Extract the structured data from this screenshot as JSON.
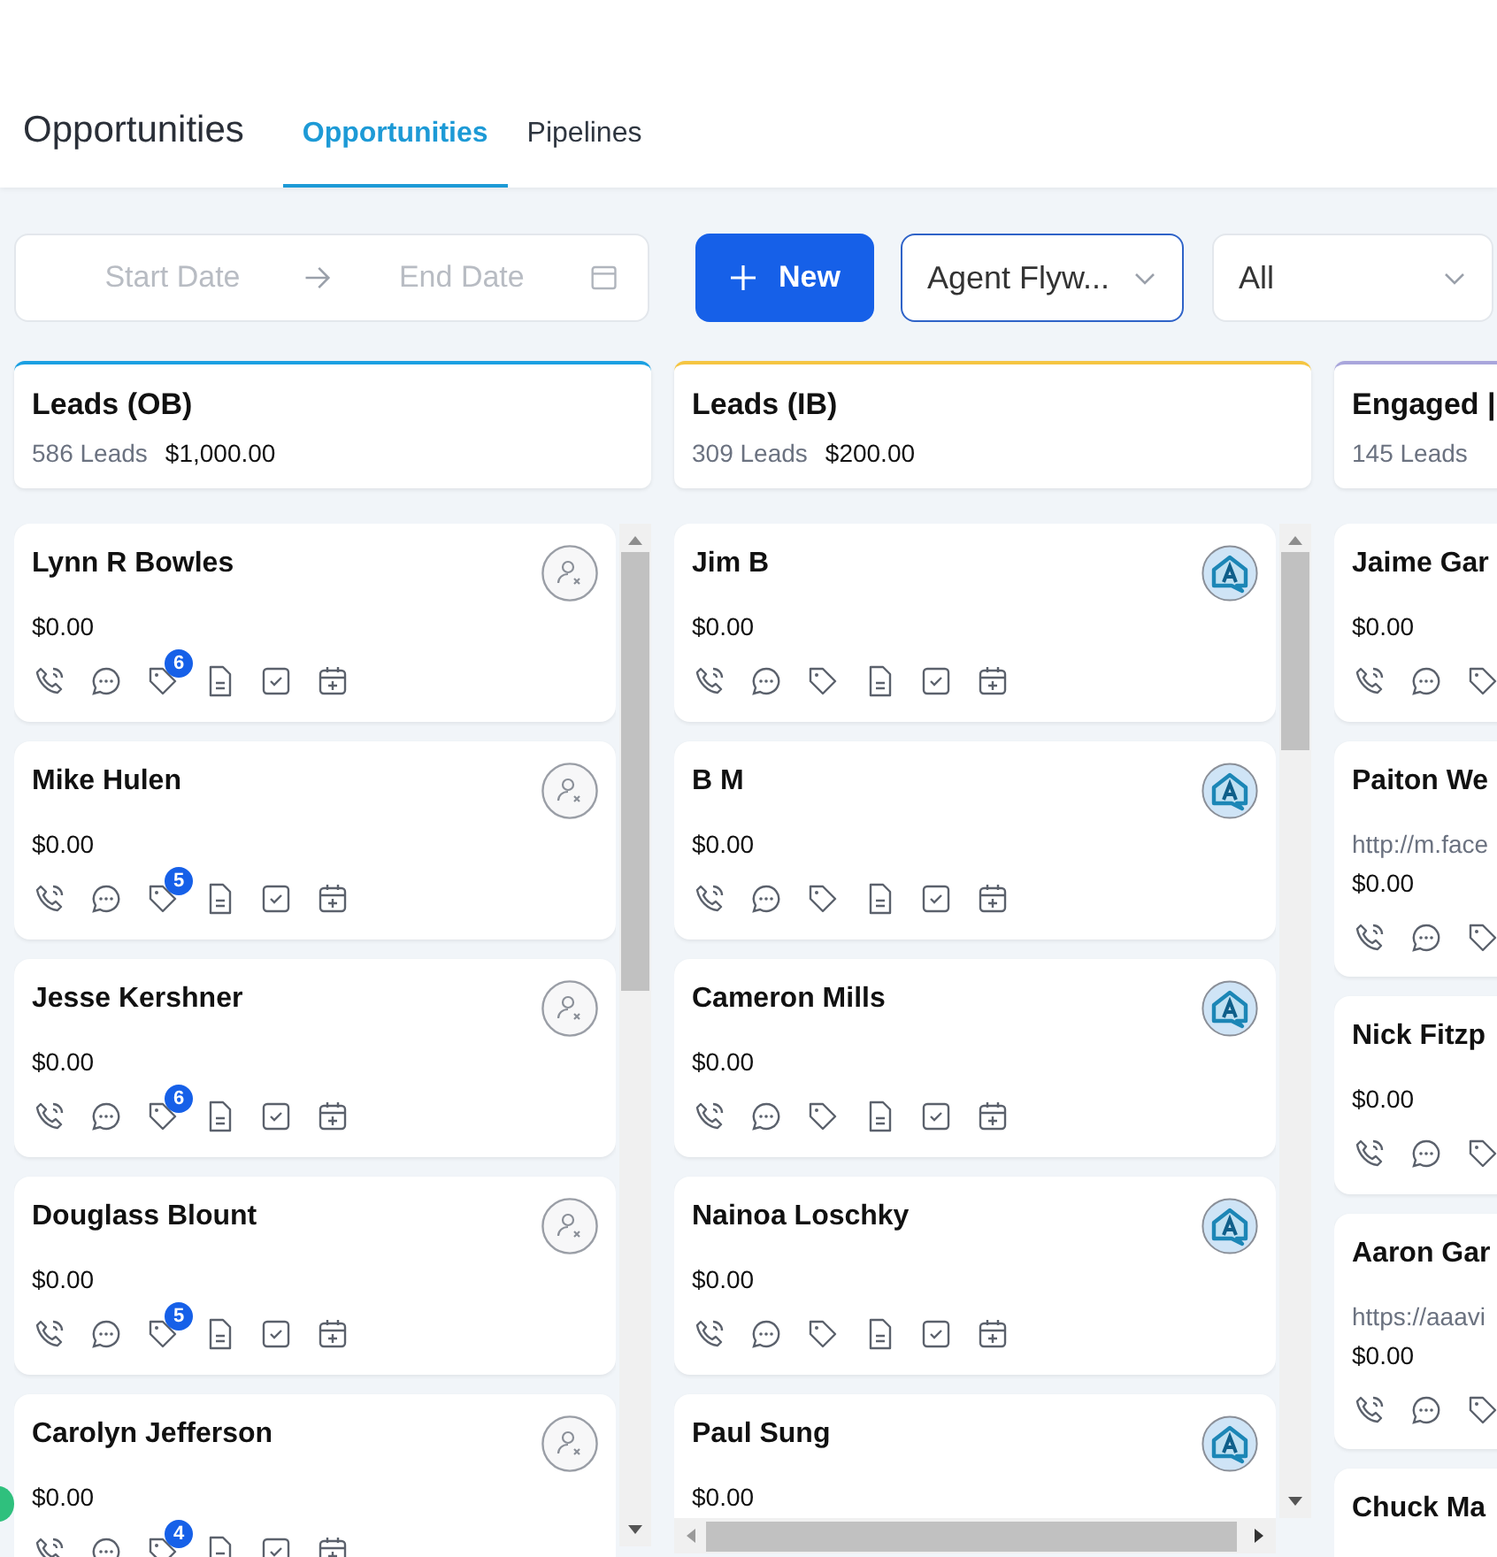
{
  "header": {
    "title": "Opportunities",
    "tabs": [
      {
        "label": "Opportunities",
        "selected": true
      },
      {
        "label": "Pipelines",
        "selected": false
      }
    ]
  },
  "filters": {
    "start_placeholder": "Start Date",
    "end_placeholder": "End Date",
    "new_button": "New",
    "agent_select": {
      "value": "Agent Flyw...",
      "focused": true
    },
    "status_select": {
      "value": "All",
      "focused": false
    }
  },
  "columns": [
    {
      "title": "Leads (OB)",
      "count": "586 Leads",
      "amount": "$1,000.00",
      "color": "#1ba0e2",
      "cards": [
        {
          "name": "Lynn R Bowles",
          "amount": "$0.00",
          "kind": "unassigned",
          "tag_count": "6"
        },
        {
          "name": "Mike Hulen",
          "amount": "$0.00",
          "kind": "unassigned",
          "tag_count": "5"
        },
        {
          "name": "Jesse Kershner",
          "amount": "$0.00",
          "kind": "unassigned",
          "tag_count": "6"
        },
        {
          "name": "Douglass Blount",
          "amount": "$0.00",
          "kind": "unassigned",
          "tag_count": "5"
        },
        {
          "name": "Carolyn Jefferson",
          "amount": "$0.00",
          "kind": "unassigned",
          "tag_count": "4"
        }
      ]
    },
    {
      "title": "Leads (IB)",
      "count": "309 Leads",
      "amount": "$200.00",
      "color": "#f5c542",
      "cards": [
        {
          "name": "Jim B",
          "amount": "$0.00",
          "kind": "agent"
        },
        {
          "name": "B M",
          "amount": "$0.00",
          "kind": "agent"
        },
        {
          "name": "Cameron Mills",
          "amount": "$0.00",
          "kind": "agent"
        },
        {
          "name": "Nainoa Loschky",
          "amount": "$0.00",
          "kind": "agent"
        },
        {
          "name": "Paul Sung",
          "amount": "$0.00",
          "kind": "agent"
        }
      ]
    },
    {
      "title": "Engaged |",
      "count": "145 Leads",
      "color": "#a9a6dc",
      "cards": [
        {
          "name": "Jaime Gar",
          "amount": "$0.00"
        },
        {
          "name": "Paiton We",
          "url": "http://m.face",
          "amount": "$0.00"
        },
        {
          "name": "Nick Fitzp",
          "amount": "$0.00"
        },
        {
          "name": "Aaron Gar",
          "url": "https://aaavi",
          "amount": "$0.00"
        },
        {
          "name": "Chuck Ma"
        }
      ]
    }
  ]
}
